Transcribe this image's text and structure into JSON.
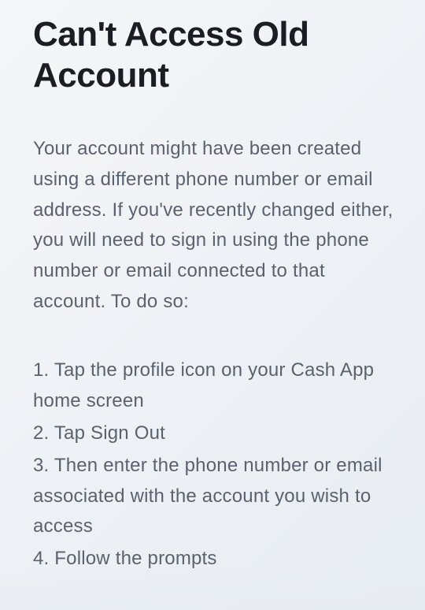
{
  "title": "Can't Access Old Account",
  "intro": "Your account might have been created using a different phone number or email address. If you've recently changed either, you will need to sign in using the phone number or email connected to that account. To do so:",
  "steps": [
    "1. Tap the profile icon on your Cash App home screen",
    "2. Tap Sign Out",
    "3. Then enter the phone number or email associated with the account you wish to access",
    "4. Follow the prompts"
  ]
}
